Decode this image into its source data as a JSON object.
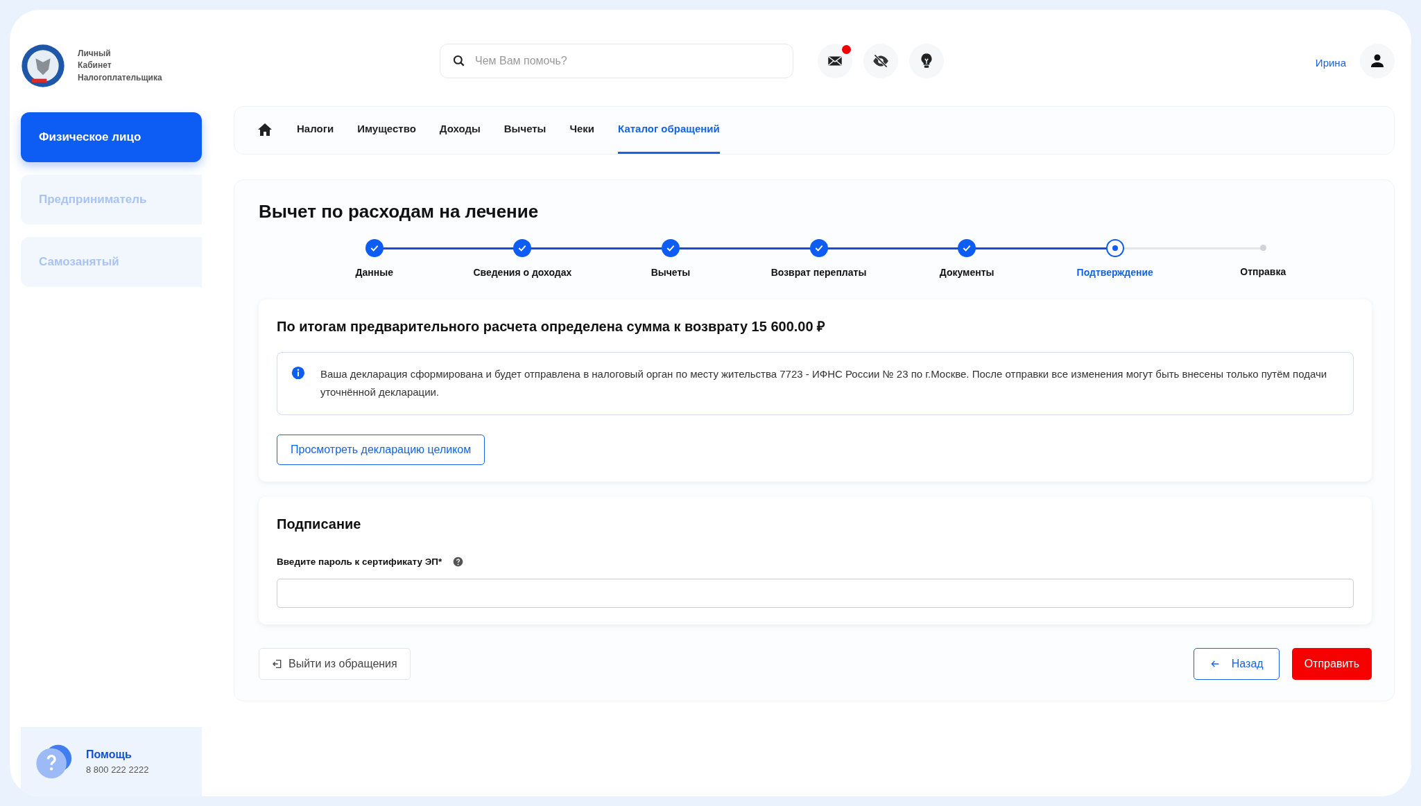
{
  "logo": {
    "lines": [
      "Личный",
      "Кабинет",
      "Налогоплательщика"
    ]
  },
  "search": {
    "placeholder": "Чем Вам помочь?"
  },
  "header_icons": [
    {
      "kind": "mail",
      "badge": true
    },
    {
      "kind": "eye-off",
      "badge": false
    },
    {
      "kind": "bulb",
      "badge": false
    }
  ],
  "user": {
    "name": "Ирина"
  },
  "sidebar": {
    "items": [
      {
        "label": "Физическое лицо",
        "selected": true
      },
      {
        "label": "Предприниматель",
        "selected": false
      },
      {
        "label": "Самозанятый",
        "selected": false
      }
    ]
  },
  "help": {
    "title": "Помощь",
    "phone": "8 800 222 2222"
  },
  "nav": {
    "items": [
      {
        "label": "Налоги",
        "selected": false
      },
      {
        "label": "Имущество",
        "selected": false
      },
      {
        "label": "Доходы",
        "selected": false
      },
      {
        "label": "Вычеты",
        "selected": false
      },
      {
        "label": "Чеки",
        "selected": false
      },
      {
        "label": "Каталог обращений",
        "selected": true
      }
    ]
  },
  "page_title": "Вычет по расходам на лечение",
  "steps": [
    {
      "label": "Данные",
      "kind": "done"
    },
    {
      "label": "Сведения о доходах",
      "kind": "done"
    },
    {
      "label": "Вычеты",
      "kind": "done"
    },
    {
      "label": "Возврат переплаты",
      "kind": "done"
    },
    {
      "label": "Документы",
      "kind": "done"
    },
    {
      "label": "Подтверждение",
      "kind": "current"
    },
    {
      "label": "Отправка",
      "kind": "pending"
    }
  ],
  "result": {
    "title": "По итогам предварительного расчета определена сумма к возврату 15 600.00 ₽",
    "info": "Ваша декларация сформирована и будет отправлена в налоговый орган по месту жительства 7723 - ИФНС России № 23 по г.Москве. После отправки все изменения могут быть внесены только путём подачи уточнённой декларации.",
    "button": "Просмотреть декларацию целиком"
  },
  "signing": {
    "title": "Подписание",
    "field_label": "Введите пароль к сертификату ЭП*"
  },
  "footer": {
    "exit": "Выйти из обращения",
    "back": "Назад",
    "submit": "Отправить"
  }
}
